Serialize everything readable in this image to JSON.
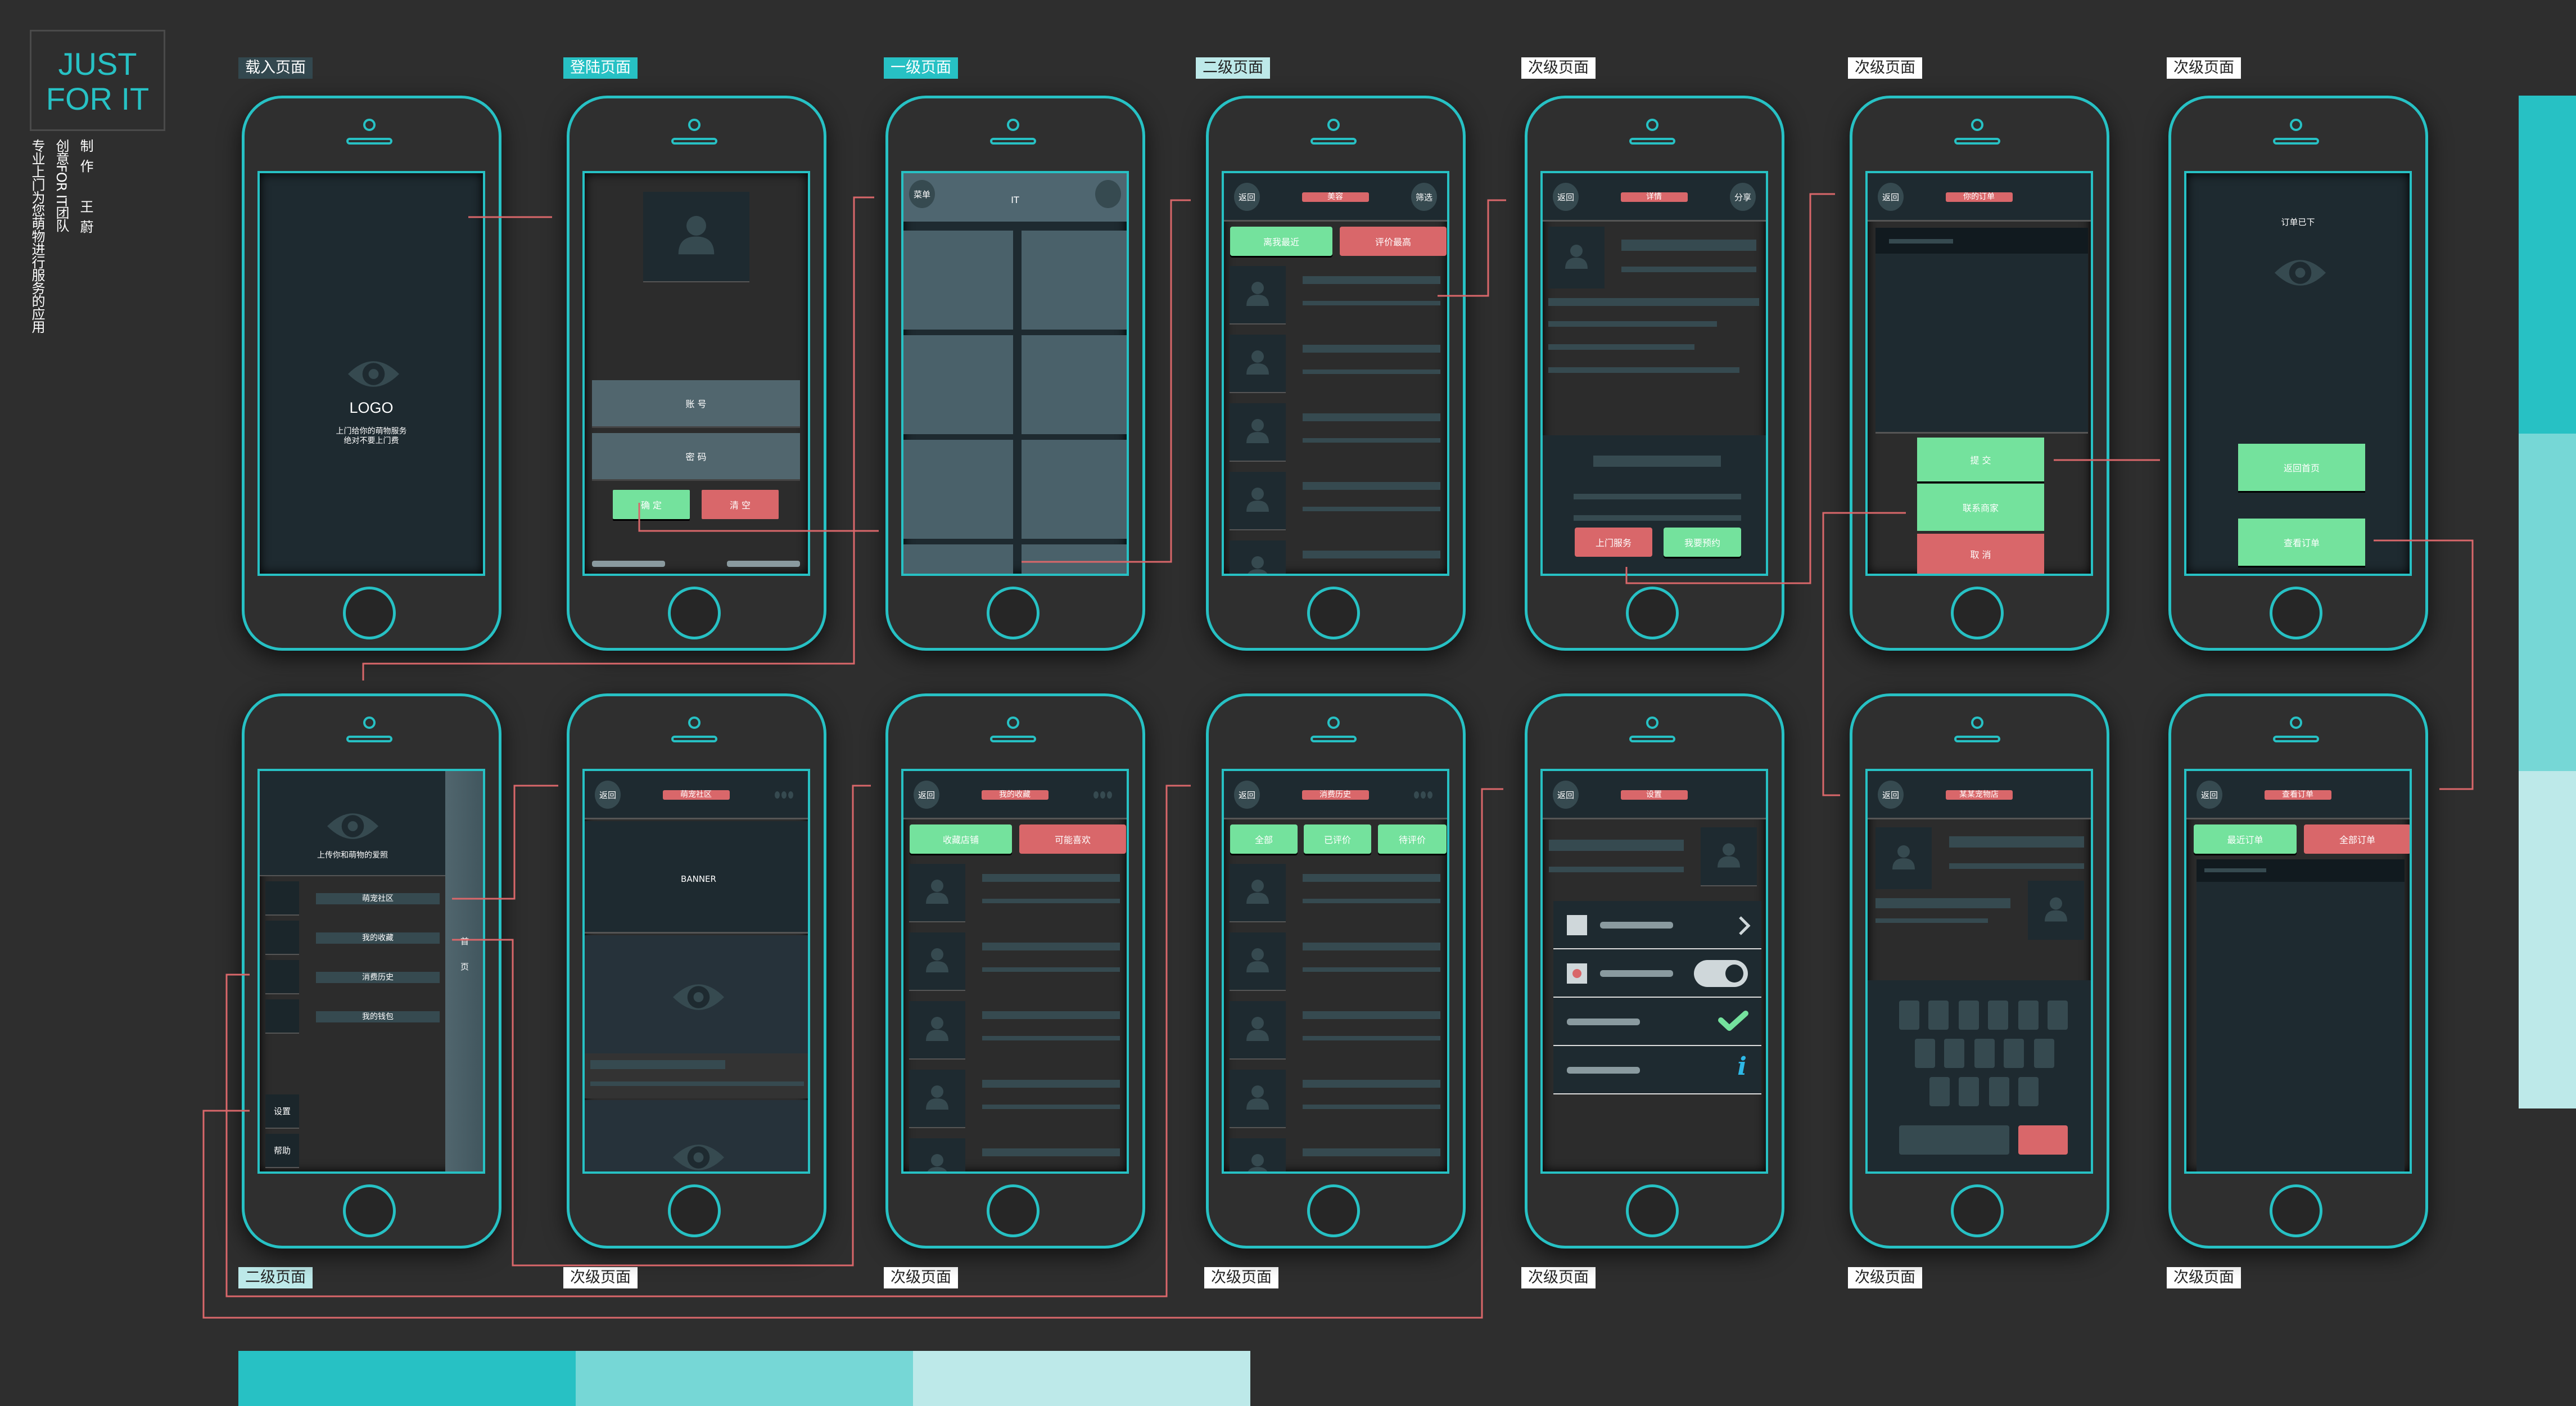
{
  "brand": {
    "line1": "JUST",
    "line2": "FOR IT",
    "col1": "专业上门为您萌物进行服务的应用",
    "col2": "创意FOR IT团队",
    "col3": "制作　王蔚"
  },
  "colors": {
    "background": "#2e2e2e",
    "accent": "#27c1c4",
    "green": "#74e29d",
    "red": "#d9676a",
    "panel": "#1e2a30",
    "placeholder": "#364a50",
    "swatches": [
      "#27c1c4",
      "#76d7d6",
      "#bde9e9"
    ]
  },
  "labels_top": [
    "载入页面",
    "登陆页面",
    "一级页面",
    "二级页面",
    "次级页面",
    "次级页面",
    "次级页面"
  ],
  "labels_bottom": [
    "二级页面",
    "次级页面",
    "次级页面",
    "次级页面",
    "次级页面",
    "次级页面",
    "次级页面"
  ],
  "splash": {
    "logo": "LOGO",
    "line1": "上门给你的萌物服务",
    "line2": "绝对不要上门费",
    "icon": "eye-icon"
  },
  "login": {
    "account": "账 号",
    "password": "密 码",
    "confirm": "确 定",
    "clear": "清 空"
  },
  "home": {
    "menu": "菜单",
    "title": "IT"
  },
  "beauty": {
    "back": "返回",
    "title": "美容",
    "filter": "筛选",
    "tabs": [
      "离我最近",
      "评价最高"
    ]
  },
  "detail": {
    "back": "返回",
    "title": "详情",
    "share": "分享",
    "buttons": [
      "上门服务",
      "我要预约"
    ]
  },
  "order": {
    "back": "返回",
    "title": "你的订单",
    "buttons": [
      "提 交",
      "联系商家",
      "取 消"
    ]
  },
  "placed": {
    "title": "订单已下",
    "buttons": [
      "返回首页",
      "查看订单"
    ]
  },
  "drawer": {
    "caption": "上传你和萌物的爱照",
    "items": [
      "萌宠社区",
      "我的收藏",
      "消费历史",
      "我的钱包"
    ],
    "settings": "设置",
    "help": "帮助",
    "home_tab": "首页"
  },
  "community": {
    "back": "返回",
    "title": "萌宠社区",
    "banner": "BANNER"
  },
  "favorites": {
    "back": "返回",
    "title": "我的收藏",
    "tabs": [
      "收藏店铺",
      "可能喜欢"
    ]
  },
  "history": {
    "back": "返回",
    "title": "消费历史",
    "tabs": [
      "全部",
      "已评价",
      "待评价"
    ]
  },
  "settings": {
    "back": "返回",
    "title": "设置",
    "toggle_on": true
  },
  "shop": {
    "back": "返回",
    "title": "某某宠物店"
  },
  "view_orders": {
    "back": "返回",
    "title": "查看订单",
    "tabs": [
      "最近订单",
      "全部订单"
    ]
  }
}
